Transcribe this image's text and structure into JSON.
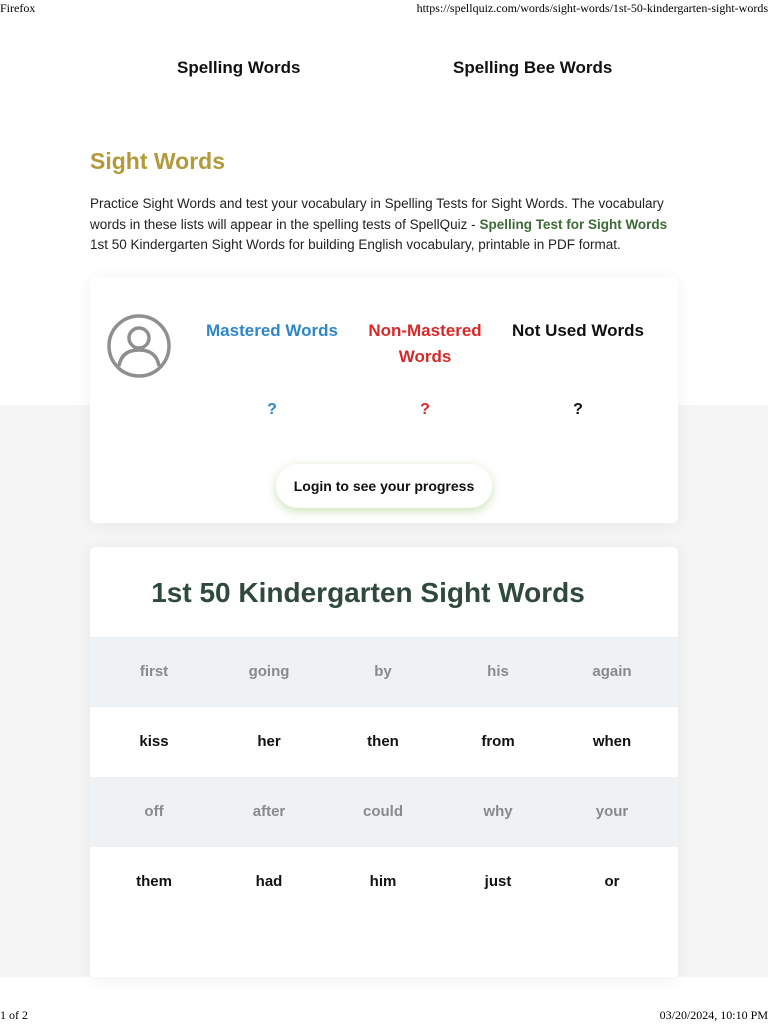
{
  "browser": {
    "app_name": "Firefox",
    "url": "https://spellquiz.com/words/sight-words/1st-50-kindergarten-sight-words"
  },
  "print_footer": {
    "page": "1 of 2",
    "datetime": "03/20/2024, 10:10 PM"
  },
  "nav": {
    "spelling_words": "Spelling Words",
    "spelling_bee_words": "Spelling Bee Words"
  },
  "section": {
    "title": "Sight Words",
    "intro_part1": "Practice Sight Words and test your vocabulary in Spelling Tests for Sight Words. The vocabulary words in these lists will appear in the spelling tests of SpellQuiz - ",
    "intro_link": "Spelling Test for Sight Words",
    "intro_part2": " 1st 50 Kindergarten Sight Words for building English vocabulary, printable in PDF format."
  },
  "progress": {
    "mastered_label": "Mastered Words",
    "non_mastered_label": "Non-Mastered Words",
    "not_used_label": "Not Used Words",
    "mastered_value": "?",
    "non_mastered_value": "?",
    "not_used_value": "?",
    "login_button": "Login to see your progress",
    "avatar_icon": "user-circle-icon",
    "colors": {
      "mastered": "#2e86c8",
      "non_mastered": "#d42a2a",
      "not_used": "#111111"
    }
  },
  "word_list": {
    "title": "1st 50 Kindergarten Sight Words",
    "rows": [
      [
        "first",
        "going",
        "by",
        "his",
        "again"
      ],
      [
        "kiss",
        "her",
        "then",
        "from",
        "when"
      ],
      [
        "off",
        "after",
        "could",
        "why",
        "your"
      ],
      [
        "them",
        "had",
        "him",
        "just",
        "or"
      ]
    ]
  }
}
